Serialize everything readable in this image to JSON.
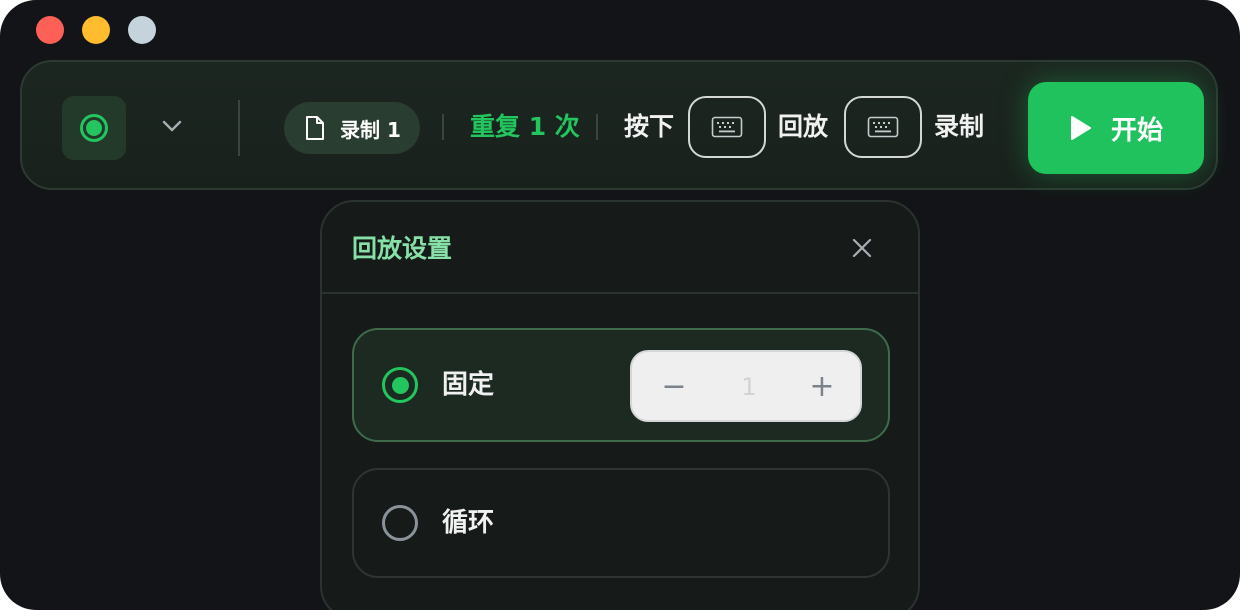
{
  "window": {
    "traffic_lights": [
      {
        "name": "close",
        "color": "#fe5f57"
      },
      {
        "name": "minimize",
        "color": "#febc2e"
      },
      {
        "name": "zoom",
        "color": "#c5d3dc"
      }
    ]
  },
  "toolbar": {
    "record_icon": "record-icon",
    "dropdown_icon": "chevron-down-icon",
    "file_pill_label": "录制 1",
    "repeat_label": "重复 1 次",
    "press_label": "按下",
    "playback_label": "回放",
    "record_label": "录制",
    "start_label": "开始"
  },
  "panel": {
    "title": "回放设置",
    "options": [
      {
        "label": "固定",
        "selected": true
      },
      {
        "label": "循环",
        "selected": false
      }
    ],
    "stepper": {
      "value": "1",
      "minus": "−",
      "plus": "+"
    }
  },
  "colors": {
    "accent": "#22c55e",
    "title_accent": "#86e0a8",
    "background": "#131417"
  }
}
